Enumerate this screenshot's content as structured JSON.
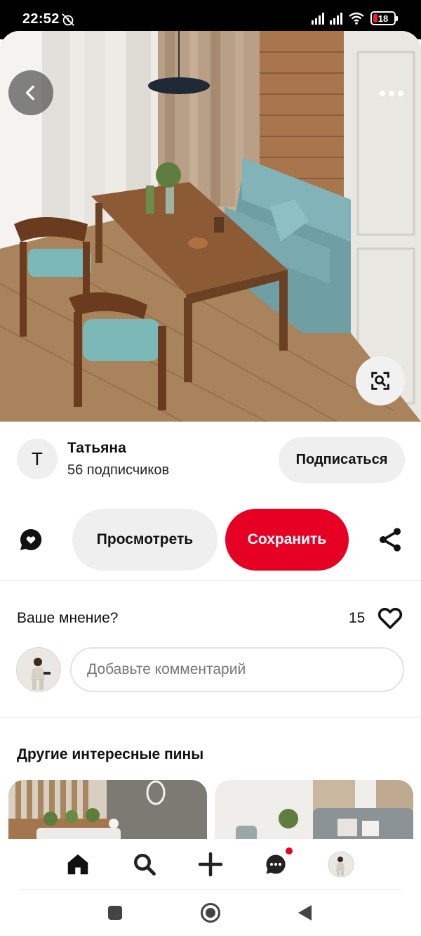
{
  "status_bar": {
    "time": "22:52",
    "battery_level": "18",
    "battery_color": "#e8202a"
  },
  "hero": {
    "back_icon": "chevron-left-icon",
    "more_icon": "more-horizontal-icon",
    "visual_search_icon": "visual-search-icon"
  },
  "author": {
    "avatar_letter": "T",
    "name": "Татьяна",
    "followers": "56 подписчиков",
    "follow_label": "Подписаться"
  },
  "actions": {
    "comment_icon": "comment-icon",
    "view_label": "Просмотреть",
    "save_label": "Сохранить",
    "share_icon": "share-icon",
    "save_color": "#e60023"
  },
  "opinion": {
    "question": "Ваше мнение?",
    "reactions_count": "15",
    "comment_placeholder": "Добавьте комментарий"
  },
  "more_pins": {
    "title": "Другие интересные пины"
  },
  "bottom_nav": {
    "items": [
      {
        "name": "home",
        "icon": "home-icon",
        "active": true
      },
      {
        "name": "search",
        "icon": "search-icon"
      },
      {
        "name": "create",
        "icon": "plus-icon"
      },
      {
        "name": "messages",
        "icon": "message-icon",
        "badge": true
      },
      {
        "name": "profile",
        "icon": "avatar"
      }
    ]
  },
  "system_nav": {
    "items": [
      "recent-apps",
      "home",
      "back"
    ]
  }
}
